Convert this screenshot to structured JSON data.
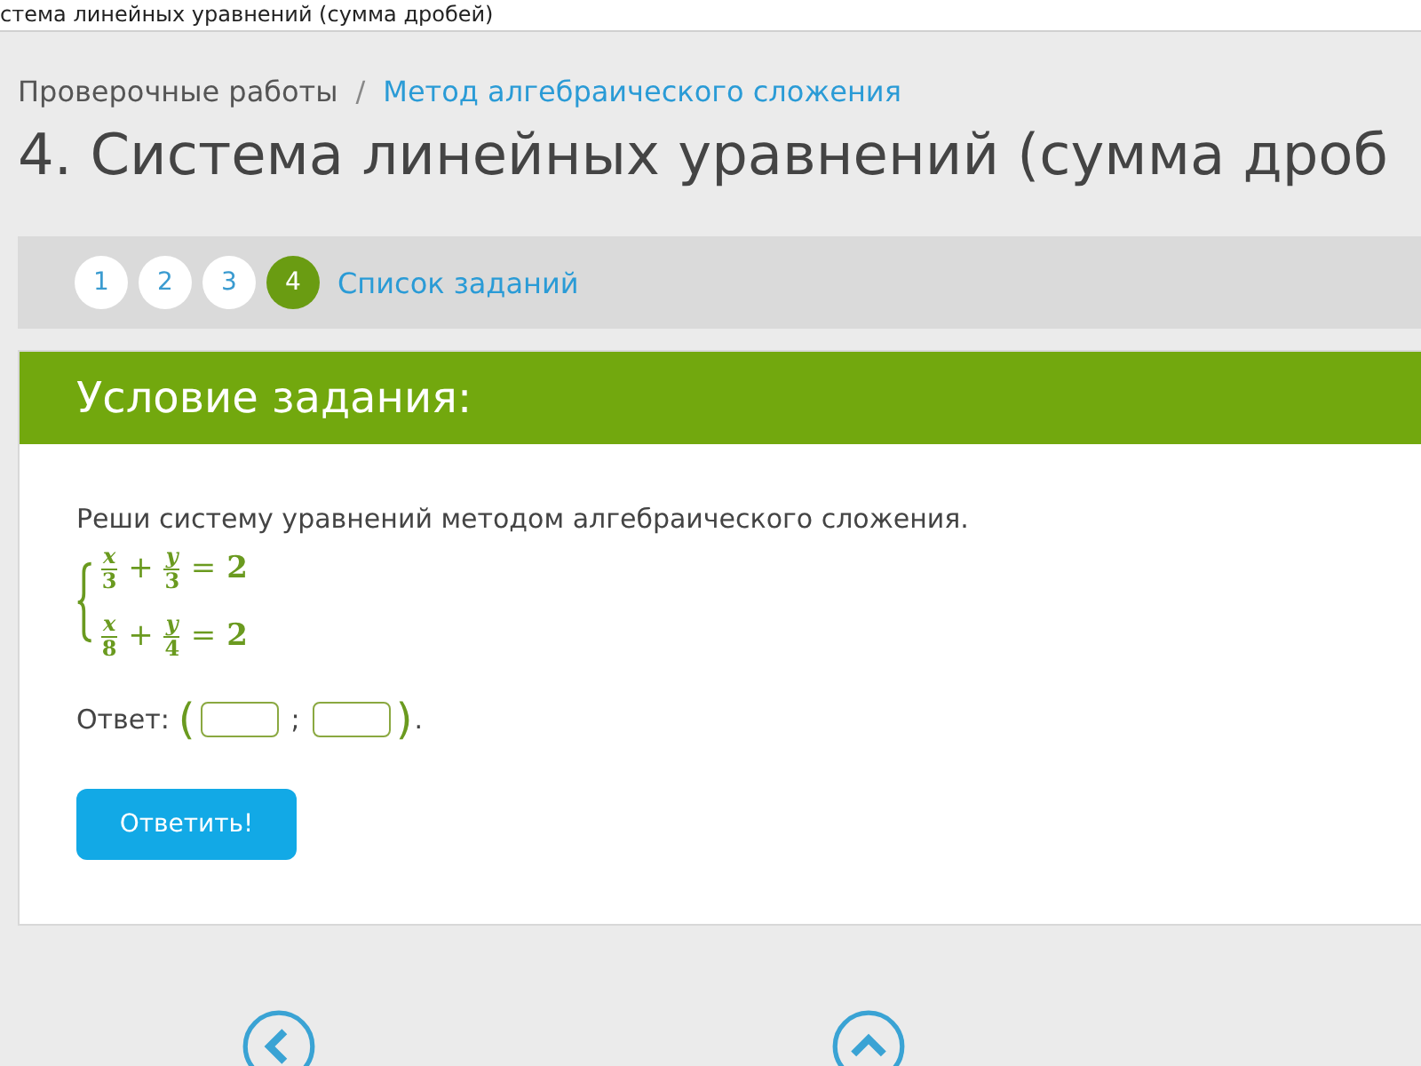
{
  "window": {
    "title": "стема линейных уравнений (сумма дробей)"
  },
  "breadcrumbs": [
    {
      "label": "Проверочные работы",
      "kind": "text"
    },
    {
      "label": "Метод алгебраического сложения",
      "kind": "link"
    }
  ],
  "breadcrumb_separator": "/",
  "page_title": "4. Система линейных уравнений (сумма дроб",
  "task_nav": {
    "pages": [
      {
        "label": "1",
        "selected": false
      },
      {
        "label": "2",
        "selected": false
      },
      {
        "label": "3",
        "selected": false
      },
      {
        "label": "4",
        "selected": true
      }
    ],
    "list_link": "Список заданий"
  },
  "task": {
    "header": "Условие задания:",
    "instruction": "Реши систему уравнений методом алгебраического сложения.",
    "equations": [
      {
        "a_num": "x",
        "a_den": "3",
        "op": "+",
        "b_num": "y",
        "b_den": "3",
        "eq": "=",
        "rhs": "2"
      },
      {
        "a_num": "x",
        "a_den": "8",
        "op": "+",
        "b_num": "y",
        "b_den": "4",
        "eq": "=",
        "rhs": "2"
      }
    ],
    "answer": {
      "label": "Ответ:",
      "open": "(",
      "separator": ";",
      "close": ")",
      "end": ".",
      "fields": [
        {
          "kind": "input"
        },
        {
          "kind": "input"
        }
      ]
    },
    "submit": "Ответить!"
  }
}
